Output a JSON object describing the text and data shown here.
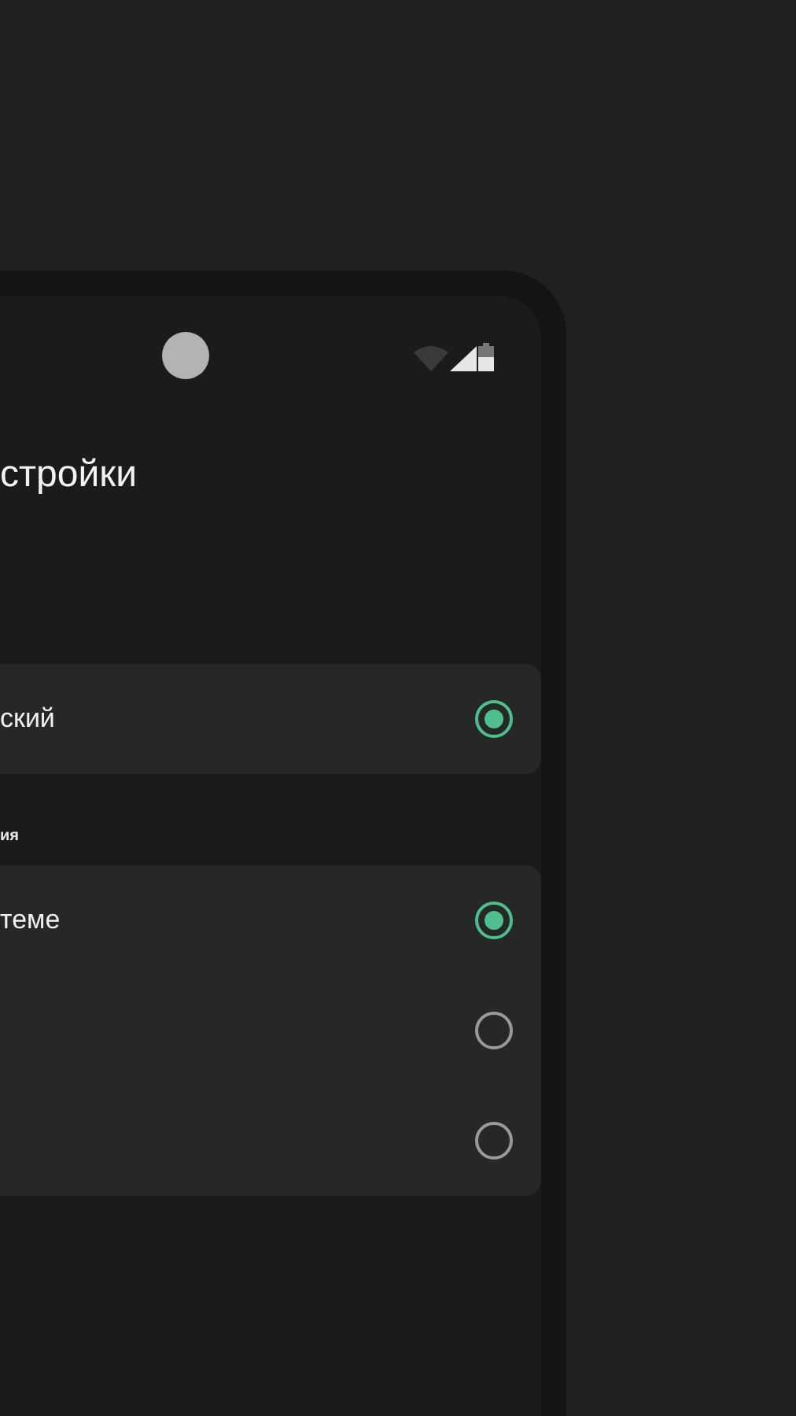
{
  "title": "стройки",
  "language": {
    "options": [
      {
        "label": "ский",
        "selected": true
      }
    ]
  },
  "theme": {
    "section_label": "ия",
    "options": [
      {
        "label": "теме",
        "selected": true
      },
      {
        "selected": false
      },
      {
        "selected": false
      }
    ]
  }
}
